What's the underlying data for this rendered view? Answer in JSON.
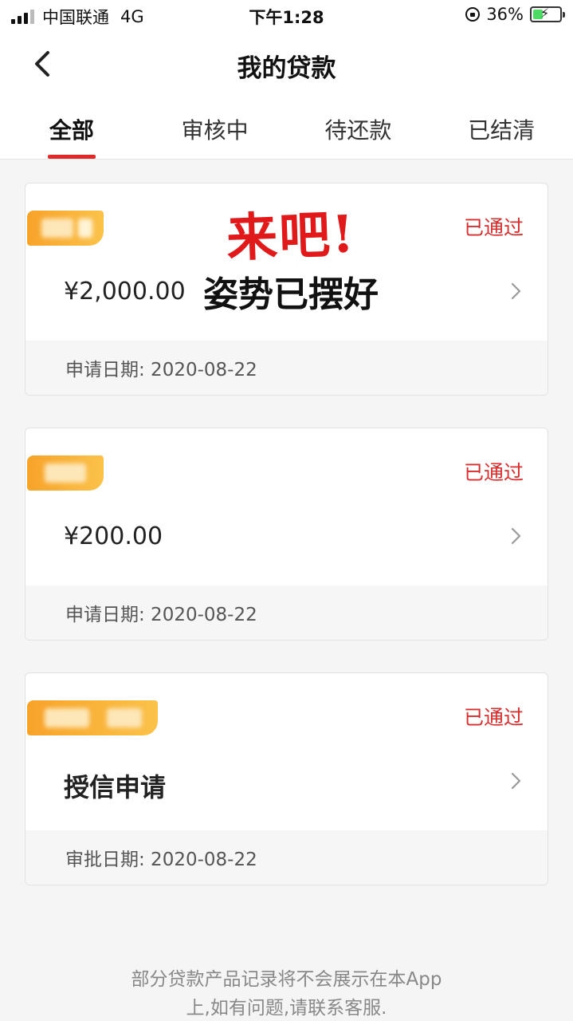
{
  "status_bar": {
    "carrier": "中国联通",
    "network": "4G",
    "time": "下午1:28",
    "battery": "36%",
    "battery_level": 0.36
  },
  "nav": {
    "title": "我的贷款"
  },
  "tabs": [
    {
      "label": "全部",
      "active": true
    },
    {
      "label": "审核中",
      "active": false
    },
    {
      "label": "待还款",
      "active": false
    },
    {
      "label": "已结清",
      "active": false
    }
  ],
  "sticker": {
    "line1": "来吧!",
    "line2": "姿势已摆好"
  },
  "loans": [
    {
      "status": "已通过",
      "amount": "¥2,000.00",
      "date": "申请日期: 2020-08-22"
    },
    {
      "status": "已通过",
      "amount": "¥200.00",
      "date": "申请日期: 2020-08-22"
    },
    {
      "status": "已通过",
      "amount": "授信申请",
      "date": "审批日期: 2020-08-22"
    }
  ],
  "footer": {
    "line1": "部分贷款产品记录将不会展示在本App",
    "line2": "上,如有问题,请联系客服."
  },
  "colors": {
    "accent": "#e02a2a",
    "status_text": "#d72f2f",
    "badge": "#f7a32a"
  }
}
